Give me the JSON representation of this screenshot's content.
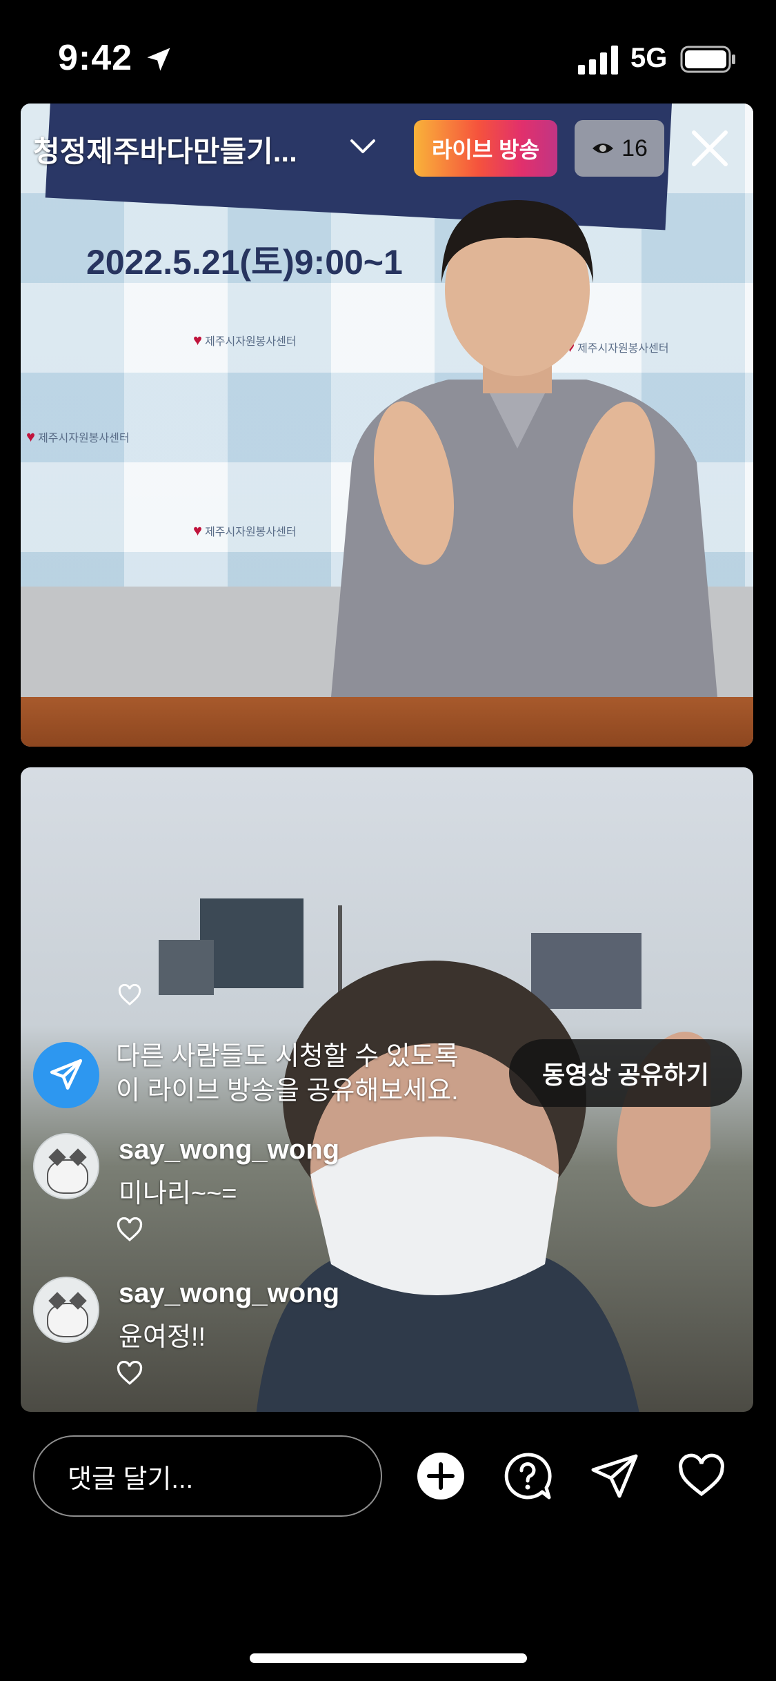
{
  "status_bar": {
    "time": "9:42",
    "network": "5G",
    "icons": [
      "location-arrow-icon",
      "cellular-signal-icon",
      "battery-icon"
    ]
  },
  "live": {
    "title": "청정제주바다만들기...",
    "badge": "라이브 방송",
    "viewer_count": "16"
  },
  "share_prompt": {
    "line1": "다른 사람들도 시청할 수 있도록",
    "line2": "이 라이브 방송을 공유해보세요.",
    "button": "동영상 공유하기"
  },
  "comments": [
    {
      "user": "say_wong_wong",
      "text": "미나리~~="
    },
    {
      "user": "say_wong_wong",
      "text": "윤여정!!"
    }
  ],
  "scene": {
    "banner_date": "2022.5.21(토)9:00~1",
    "logo_text": "제주시자원봉사센터"
  },
  "bottom_bar": {
    "placeholder": "댓글 달기...",
    "actions": [
      "add-icon",
      "question-icon",
      "send-icon",
      "heart-icon"
    ]
  },
  "colors": {
    "share_blue": "#2d97f0",
    "live_gradient": [
      "#f9b33a",
      "#f5533d",
      "#e1306c",
      "#c13584"
    ]
  }
}
